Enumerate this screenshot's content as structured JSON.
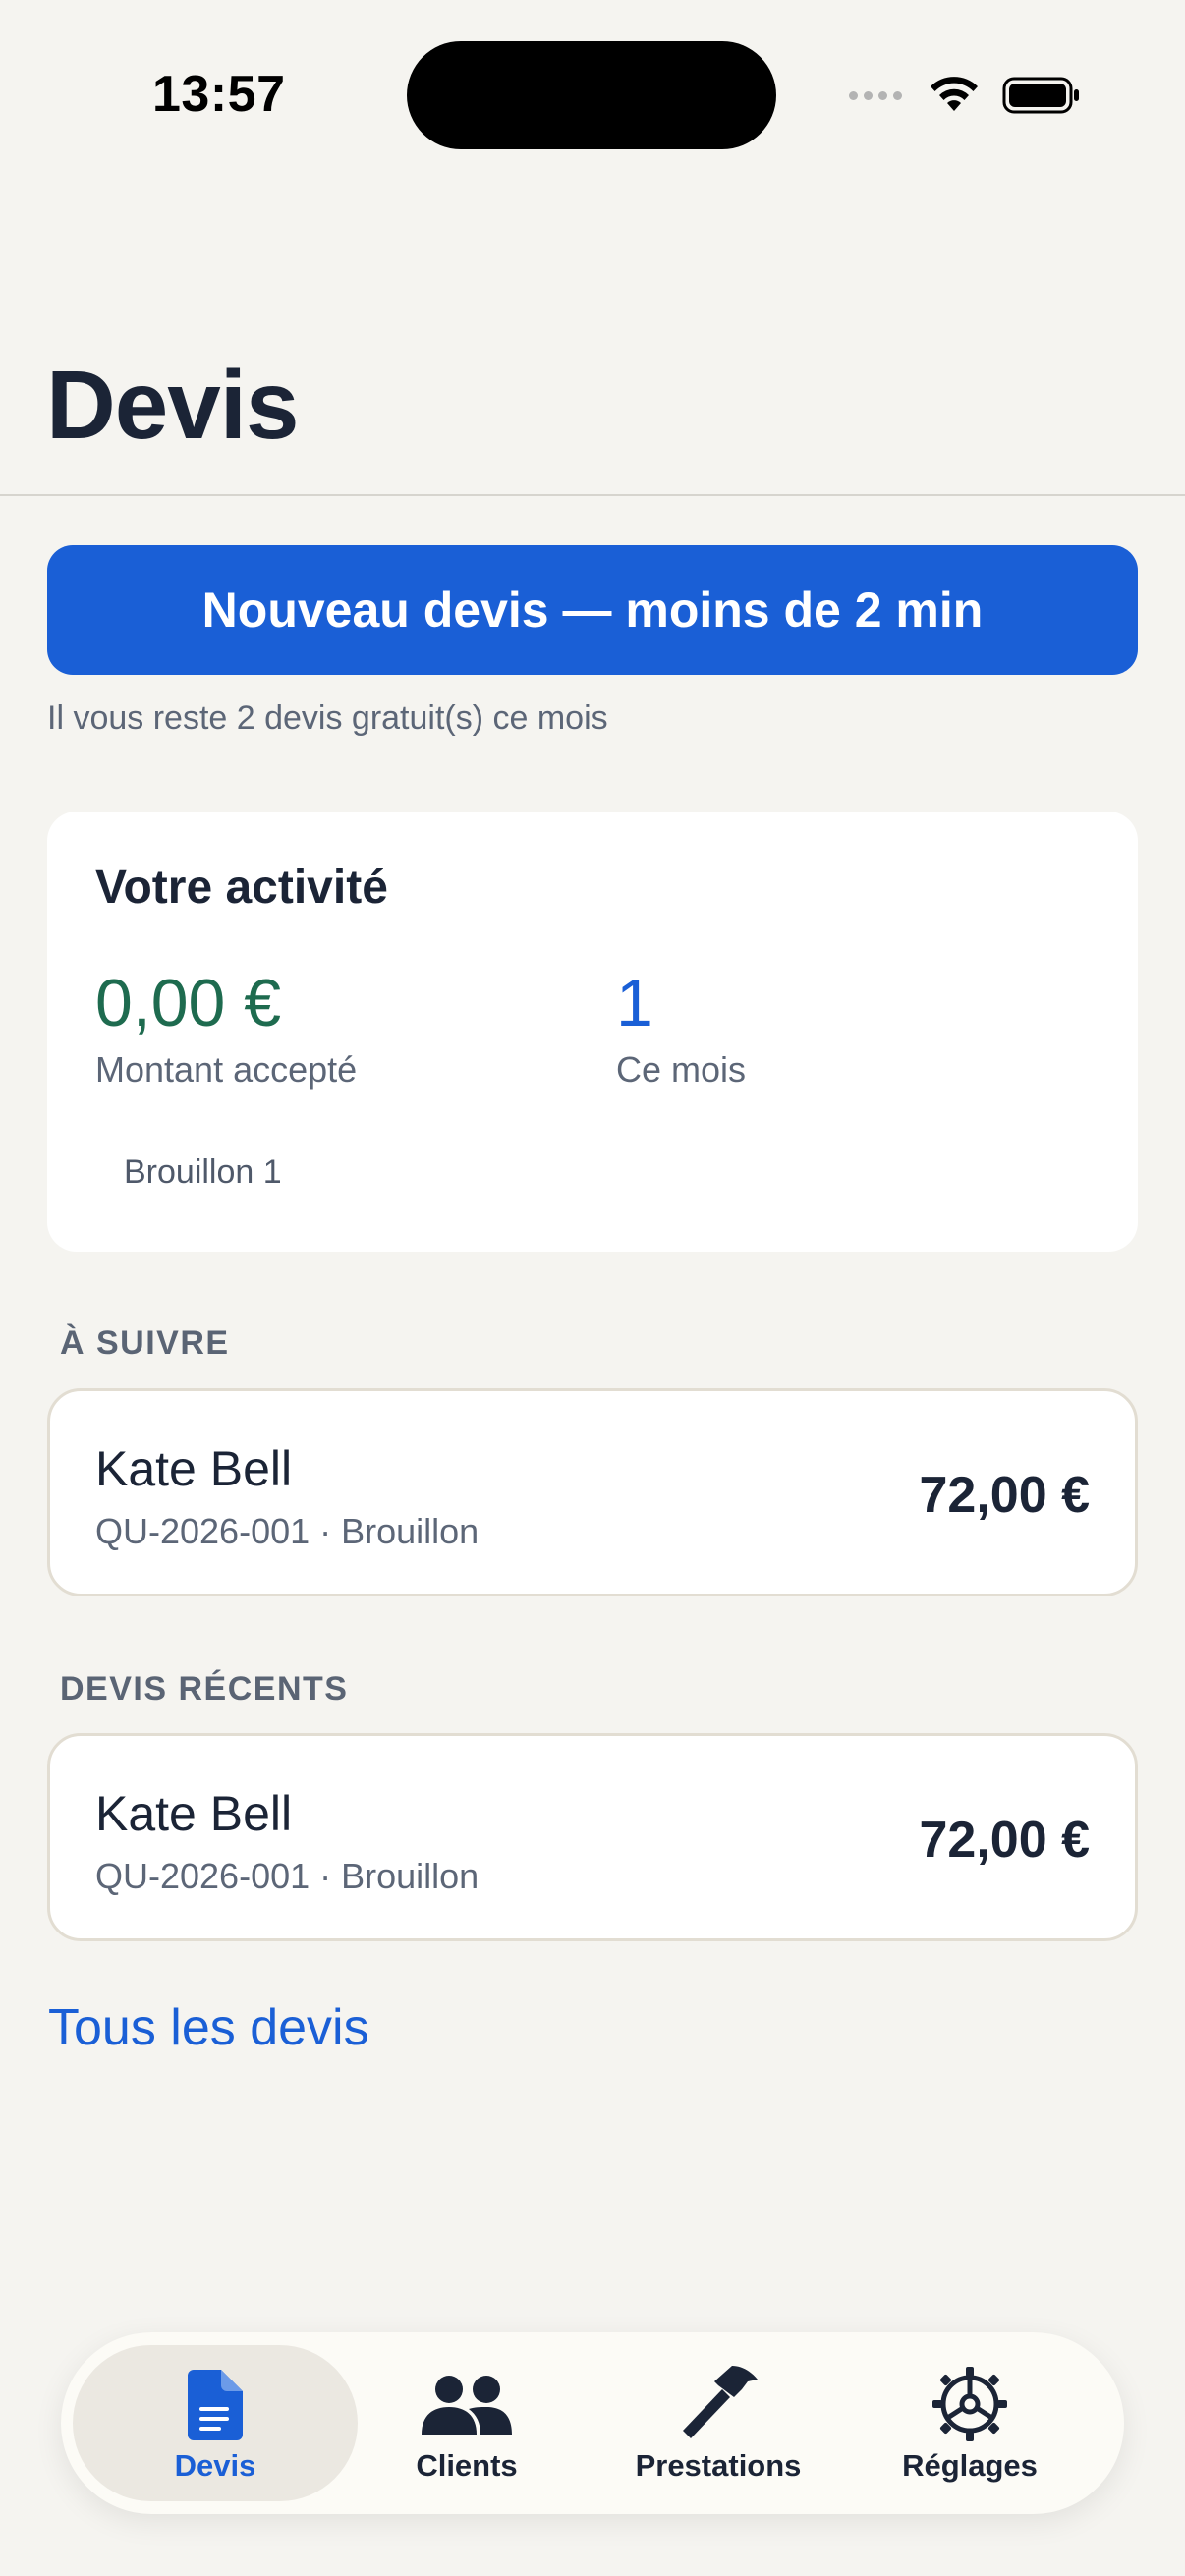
{
  "status_bar": {
    "time": "13:57"
  },
  "header": {
    "title": "Devis"
  },
  "actions": {
    "new_quote_label": "Nouveau devis — moins de 2 min",
    "free_quota_text": "Il vous reste 2 devis gratuit(s) ce mois"
  },
  "activity": {
    "title": "Votre activité",
    "accepted_amount": "0,00 €",
    "accepted_amount_label": "Montant accepté",
    "this_month_count": "1",
    "this_month_label": "Ce mois",
    "draft_summary": "Brouillon 1"
  },
  "follow_up": {
    "header": "À SUIVRE",
    "items": [
      {
        "client": "Kate Bell",
        "meta": "QU-2026-001 · Brouillon",
        "amount": "72,00 €"
      }
    ]
  },
  "recent": {
    "header": "DEVIS RÉCENTS",
    "items": [
      {
        "client": "Kate Bell",
        "meta": "QU-2026-001 · Brouillon",
        "amount": "72,00 €"
      }
    ]
  },
  "all_quotes_link": "Tous les devis",
  "tab_bar": {
    "selected": "Devis",
    "accent_color": "#1a5fd6",
    "items": [
      {
        "label": "Devis",
        "icon": "document-icon"
      },
      {
        "label": "Clients",
        "icon": "people-icon"
      },
      {
        "label": "Prestations",
        "icon": "hammer-icon"
      },
      {
        "label": "Réglages",
        "icon": "gear-icon"
      }
    ]
  }
}
